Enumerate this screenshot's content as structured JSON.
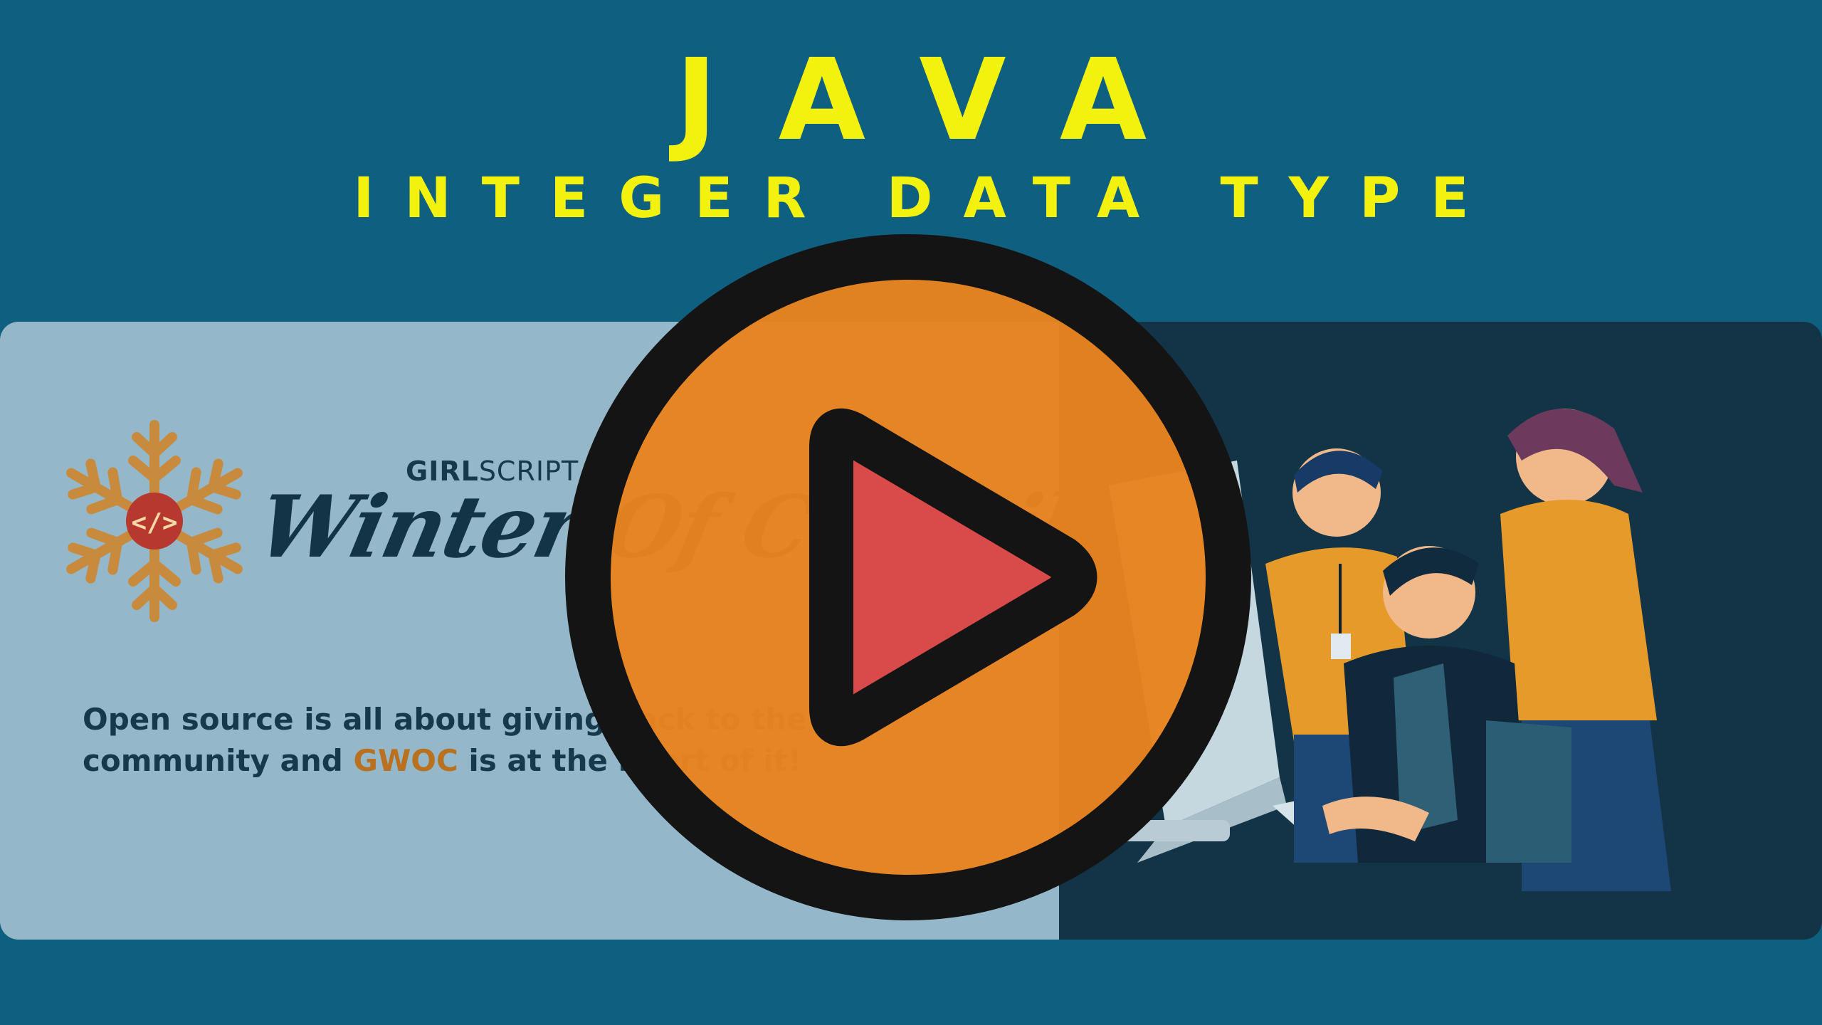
{
  "title": "JAVA",
  "subtitle": "INTEGER DATA TYPE",
  "banner": {
    "brand_small_bold": "GIRL",
    "brand_small_light": "SCRIPT",
    "brand_script": "Winter Of Contributing",
    "tagline_part1": "Open source is all about giving back to the community and ",
    "tagline_highlight": "GWOC",
    "tagline_part2": " is at the heart of it!"
  },
  "colors": {
    "background": "#0f5f80",
    "title": "#f3f20f",
    "play_orange": "#e8831f",
    "play_triangle": "#d94a4a"
  },
  "icons": {
    "logo": "snowflake-icon",
    "video": "play-button-icon"
  }
}
